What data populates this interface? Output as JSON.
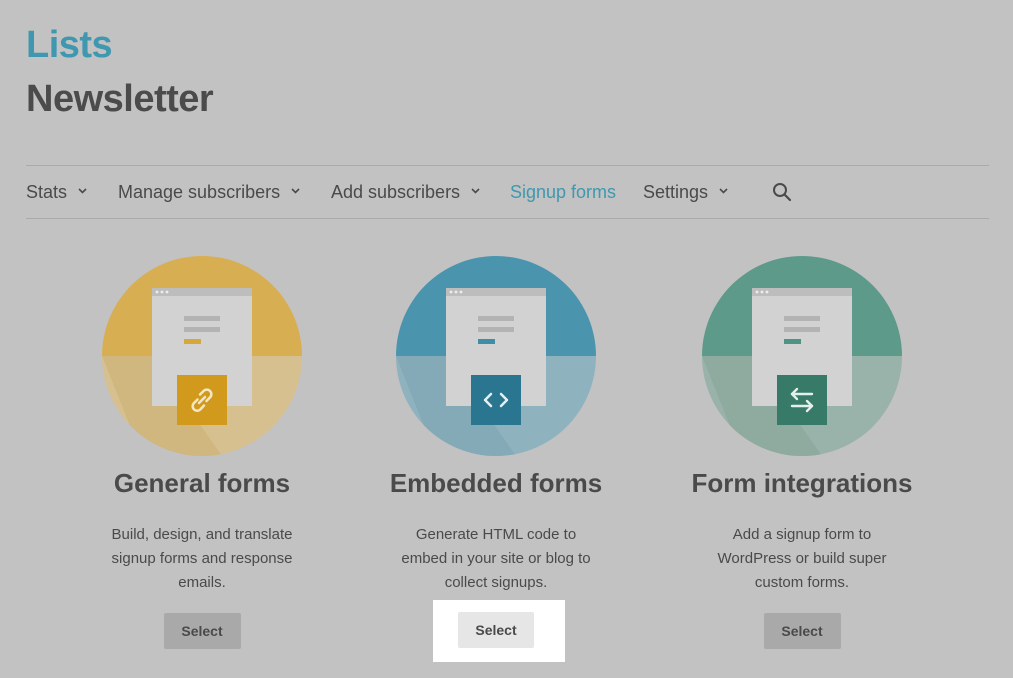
{
  "header": {
    "breadcrumb": "Lists",
    "title": "Newsletter"
  },
  "nav": {
    "items": [
      {
        "label": "Stats",
        "dropdown": true
      },
      {
        "label": "Manage subscribers",
        "dropdown": true
      },
      {
        "label": "Add subscribers",
        "dropdown": true
      },
      {
        "label": "Signup forms",
        "dropdown": false,
        "active": true
      },
      {
        "label": "Settings",
        "dropdown": true
      }
    ],
    "search_icon": "search-icon"
  },
  "cards": [
    {
      "title": "General forms",
      "description": "Build, design, and translate signup forms and response emails.",
      "button": "Select",
      "icon": "link-icon",
      "color": "#d8ae53"
    },
    {
      "title": "Embedded forms",
      "description": "Generate HTML code to embed in your site or blog to collect signups.",
      "button": "Select",
      "icon": "code-icon",
      "color": "#4a95ad"
    },
    {
      "title": "Form integrations",
      "description": "Add a signup form to WordPress or build super custom forms.",
      "button": "Select",
      "icon": "swap-arrows-icon",
      "color": "#5e9a8a"
    }
  ],
  "colors": {
    "accent": "#3f98b0",
    "background": "#c2c2c2"
  }
}
